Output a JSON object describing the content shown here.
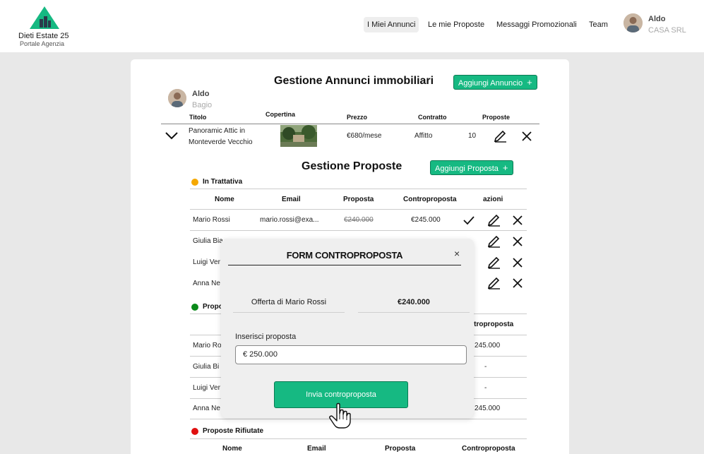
{
  "header": {
    "brand": "Dieti Estate 25",
    "brand_sub": "Portale Agenzia",
    "nav": [
      "I Miei Annunci",
      "Le mie Proposte",
      "Messaggi Promozionali",
      "Team"
    ],
    "user_name": "Aldo",
    "user_company": "CASA SRL"
  },
  "listings": {
    "title": "Gestione Annunci immobiliari",
    "add_button": "Aggiungi Annuncio",
    "owner_first": "Aldo",
    "owner_last": "Bagio",
    "columns": [
      "Titolo",
      "Copertina",
      "Prezzo",
      "Contratto",
      "Proposte"
    ],
    "row": {
      "title_line1": "Panoramic Attic in",
      "title_line2": "Monteverde Vecchio",
      "price": "€680/mese",
      "contract": "Affitto",
      "proposals": "10"
    }
  },
  "proposals": {
    "title": "Gestione Proposte",
    "add_button": "Aggiungi Proposta",
    "in_progress_label": "In Trattativa",
    "accepted_label": "Propo",
    "rejected_label": "Proposte Rifiutate",
    "columns": [
      "Nome",
      "Email",
      "Proposta",
      "Controproposta",
      "azioni"
    ],
    "in_progress_rows": [
      {
        "name": "Mario Rossi",
        "email": "mario.rossi@exa...",
        "offer": "€240.000",
        "counter": "€245.000"
      },
      {
        "name": "Giulia Bia"
      },
      {
        "name": "Luigi Ver"
      },
      {
        "name": "Anna Ne"
      }
    ],
    "accepted_counter_header": "ntroproposta",
    "accepted_rows": [
      {
        "name": "Mario Ro",
        "counter": "245.000"
      },
      {
        "name": "Giulia Bi",
        "counter": "-"
      },
      {
        "name": "Luigi Ver",
        "counter": "-"
      },
      {
        "name": "Anna Ne",
        "counter": "245.000"
      }
    ],
    "rejected_columns": [
      "Nome",
      "Email",
      "Proposta",
      "Controproposta"
    ]
  },
  "modal": {
    "title": "FORM CONTROPROPOSTA",
    "close": "×",
    "offer_label": "Offerta di Mario Rossi",
    "offer_value": "€240.000",
    "input_label": "Inserisci proposta",
    "input_value": "€ 250.000",
    "submit_label": "Invia controproposta"
  },
  "colors": {
    "accent": "#16b982",
    "status_in_progress": "#f5a800",
    "status_accepted": "#0a8a1a",
    "status_rejected": "#e01010"
  }
}
